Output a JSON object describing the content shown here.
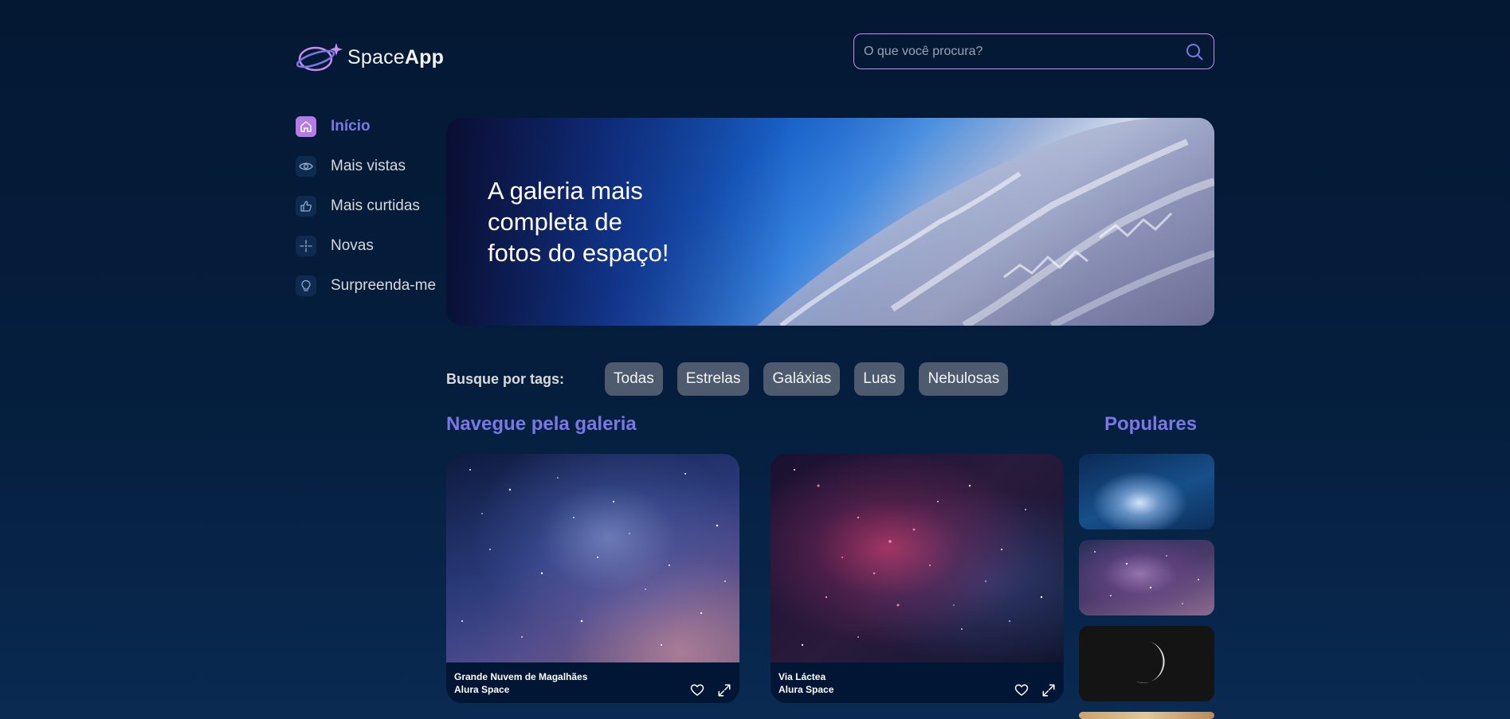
{
  "header": {
    "logo_prefix": "Space",
    "logo_bold": "App",
    "search_placeholder": "O que você procura?",
    "search_icon": "search-icon"
  },
  "sidebar": {
    "items": [
      {
        "label": "Início",
        "icon": "home-icon",
        "active": true
      },
      {
        "label": "Mais vistas",
        "icon": "eye-icon",
        "active": false
      },
      {
        "label": "Mais curtidas",
        "icon": "thumbs-up-icon",
        "active": false
      },
      {
        "label": "Novas",
        "icon": "sparkle-icon",
        "active": false
      },
      {
        "label": "Surpreenda-me",
        "icon": "lightbulb-icon",
        "active": false
      }
    ]
  },
  "banner": {
    "line1": "A galeria mais",
    "line2": "completa de",
    "line3": "fotos do espaço!"
  },
  "tags": {
    "label": "Busque por tags:",
    "items": [
      "Todas",
      "Estrelas",
      "Galáxias",
      "Luas",
      "Nebulosas"
    ]
  },
  "gallery": {
    "title": "Navegue pela galeria",
    "cards": [
      {
        "title": "Grande Nuvem de Magalhães",
        "source": "Alura Space"
      },
      {
        "title": "Via Láctea",
        "source": "Alura Space"
      }
    ]
  },
  "popular": {
    "title": "Populares"
  },
  "colors": {
    "accent": "#7b78e5",
    "active_icon_bg": "#b37be6",
    "tag_bg": "#4e5a6e",
    "background": "#041833",
    "search_border": "#c98cf1"
  }
}
